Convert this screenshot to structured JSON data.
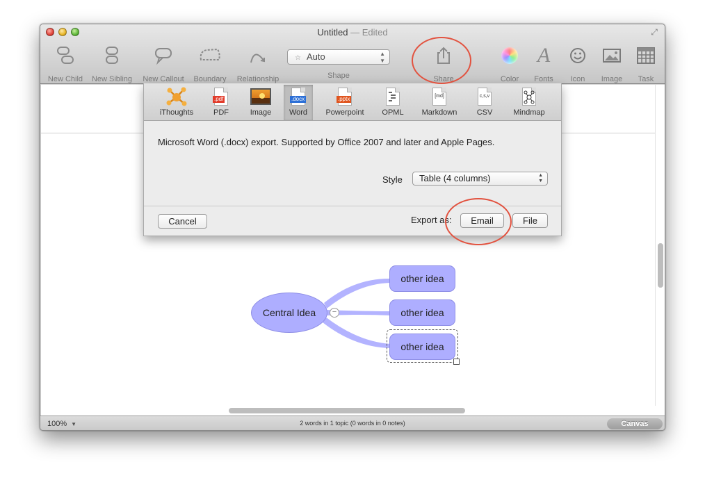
{
  "window": {
    "title": "Untitled",
    "edited": "— Edited"
  },
  "toolbar": {
    "new_child": "New Child",
    "new_sibling": "New Sibling",
    "new_callout": "New Callout",
    "boundary": "Boundary",
    "relationship": "Relationship",
    "shape_value": "Auto",
    "shape_label": "Shape",
    "share": "Share",
    "color": "Color",
    "fonts": "Fonts",
    "icon": "Icon",
    "image": "Image",
    "task": "Task"
  },
  "export_sheet": {
    "formats": [
      {
        "label": "iThoughts",
        "icon": "ithoughts-icon"
      },
      {
        "label": "PDF",
        "tag": ".pdf",
        "icon": "pdf-file-icon"
      },
      {
        "label": "Image",
        "icon": "image-file-icon"
      },
      {
        "label": "Word",
        "tag": ".docx",
        "icon": "word-file-icon"
      },
      {
        "label": "Powerpoint",
        "tag": ".pptx",
        "icon": "powerpoint-file-icon"
      },
      {
        "label": "OPML",
        "icon": "opml-file-icon"
      },
      {
        "label": "Markdown",
        "tag": "[md]",
        "icon": "markdown-file-icon"
      },
      {
        "label": "CSV",
        "tag": "c,s,v",
        "icon": "csv-file-icon"
      },
      {
        "label": "Mindmap",
        "icon": "mindmap-file-icon"
      }
    ],
    "selected_format": "Word",
    "description": "Microsoft Word (.docx) export. Supported by Office 2007 and later and Apple Pages.",
    "style_label": "Style",
    "style_value": "Table (4 columns)",
    "cancel": "Cancel",
    "export_as": "Export as:",
    "email": "Email",
    "file": "File"
  },
  "mindmap": {
    "central": "Central Idea",
    "children": [
      "other idea",
      "other idea",
      "other idea"
    ],
    "collapse_symbol": "−"
  },
  "statusbar": {
    "zoom": "100%",
    "zoom_caret": "▼",
    "status": "2 words in 1 topic (0 words in 0 notes)",
    "canvas": "Canvas"
  },
  "colors": {
    "node_fill": "#aeaeff",
    "connector": "#b3b3ff",
    "annotation": "#e2523f"
  }
}
